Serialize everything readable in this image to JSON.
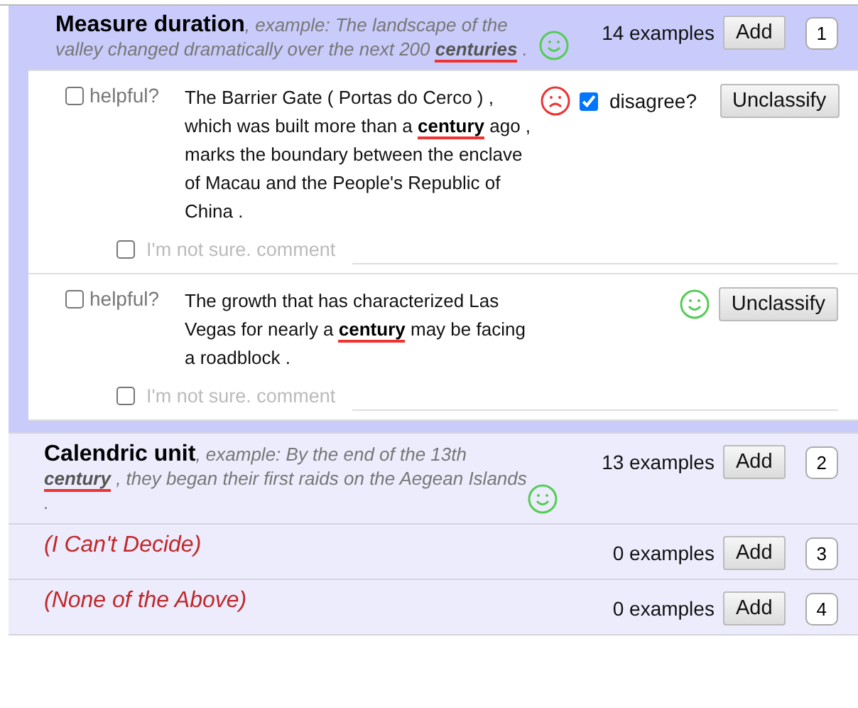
{
  "categories": [
    {
      "kind": "label",
      "title": "Measure duration",
      "example_before": ", example: The landscape of the valley changed dramatically over the next 200 ",
      "example_keyword": "centuries",
      "example_after": " .",
      "count": "14 examples",
      "add": "Add",
      "key": "1",
      "selected": true,
      "examples": [
        {
          "helpful": {
            "label": "helpful?",
            "checked": false
          },
          "before": "The Barrier Gate ( Portas do Cerco ) , which was built more than a ",
          "keyword": "century",
          "after": " ago , marks the boundary between the enclave of Macau and the People's Republic of China .",
          "approved": false,
          "disagree": {
            "label": "disagree?",
            "checked": true
          },
          "button": "Unclassify",
          "unsure": {
            "label": "I'm not sure. comment",
            "checked": false
          }
        },
        {
          "helpful": {
            "label": "helpful?",
            "checked": false
          },
          "before": "The growth that has characterized Las Vegas for nearly a ",
          "keyword": "century",
          "after": " may be facing a roadblock .",
          "approved": true,
          "button": "Unclassify",
          "unsure": {
            "label": "I'm not sure. comment",
            "checked": false
          }
        }
      ]
    },
    {
      "kind": "label",
      "title": "Calendric unit",
      "example_before": ", example: By the end of the 13th ",
      "example_keyword": "century",
      "example_after": " , they began their first raids on the Aegean Islands .",
      "count": "13 examples",
      "add": "Add",
      "key": "2",
      "selected": false
    },
    {
      "kind": "special",
      "title": "(I Can't Decide)",
      "count": "0 examples",
      "add": "Add",
      "key": "3",
      "selected": false
    },
    {
      "kind": "special",
      "title": "(None of the Above)",
      "count": "0 examples",
      "add": "Add",
      "key": "4",
      "selected": false
    }
  ]
}
